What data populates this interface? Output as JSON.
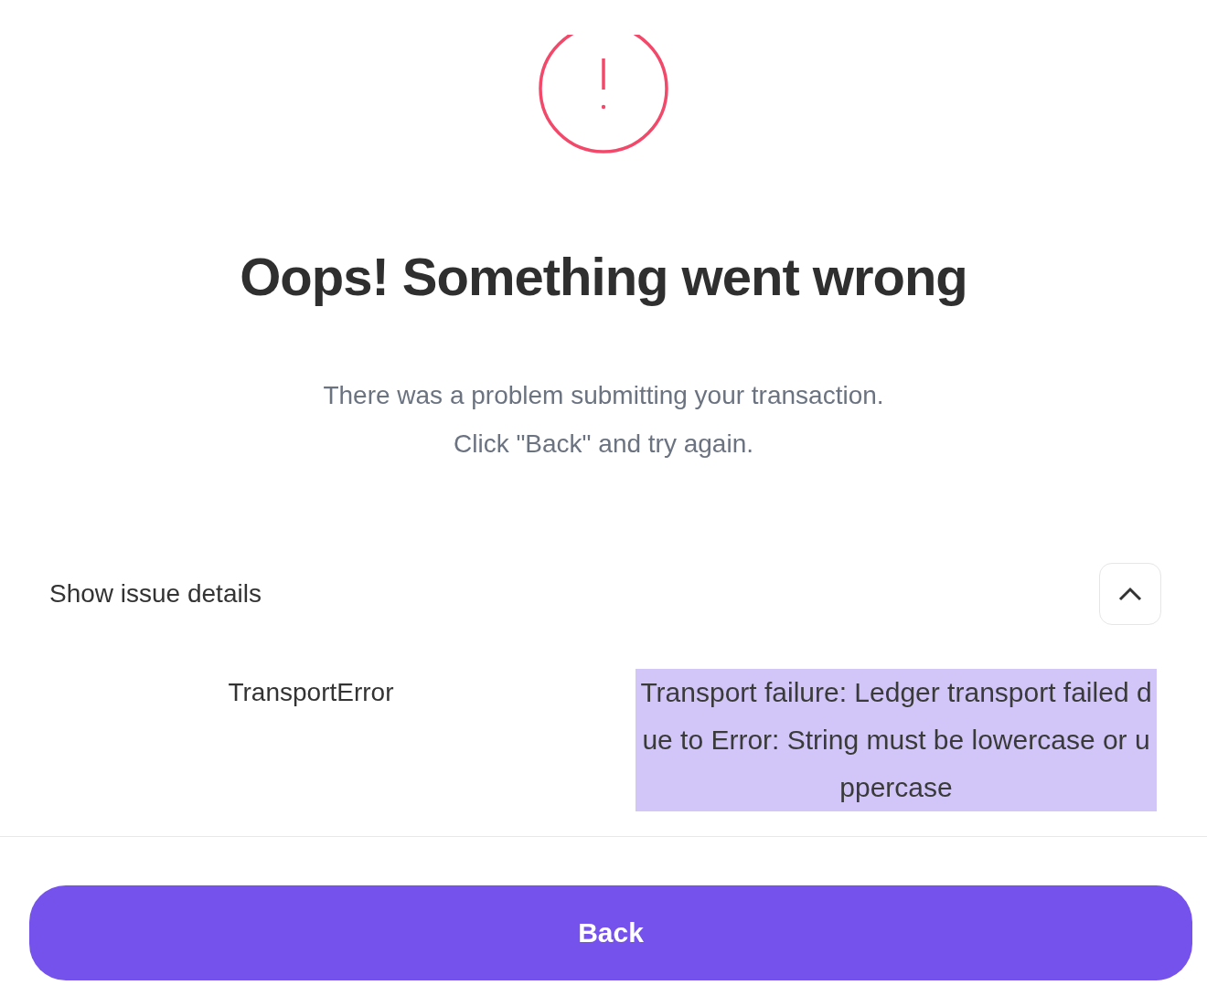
{
  "heading": "Oops! Something went wrong",
  "message": [
    "There was a problem submitting your transaction.",
    "Click \"Back\" and try again."
  ],
  "issue_details": {
    "label": "Show issue details",
    "expanded": true,
    "error_name": "TransportError",
    "error_message": {
      "text": "Transport failure: Ledger transport failed due to Error: String must be lowercase or uppercase",
      "highlighted": true
    }
  },
  "buttons": [
    {
      "label": "Back"
    }
  ]
}
